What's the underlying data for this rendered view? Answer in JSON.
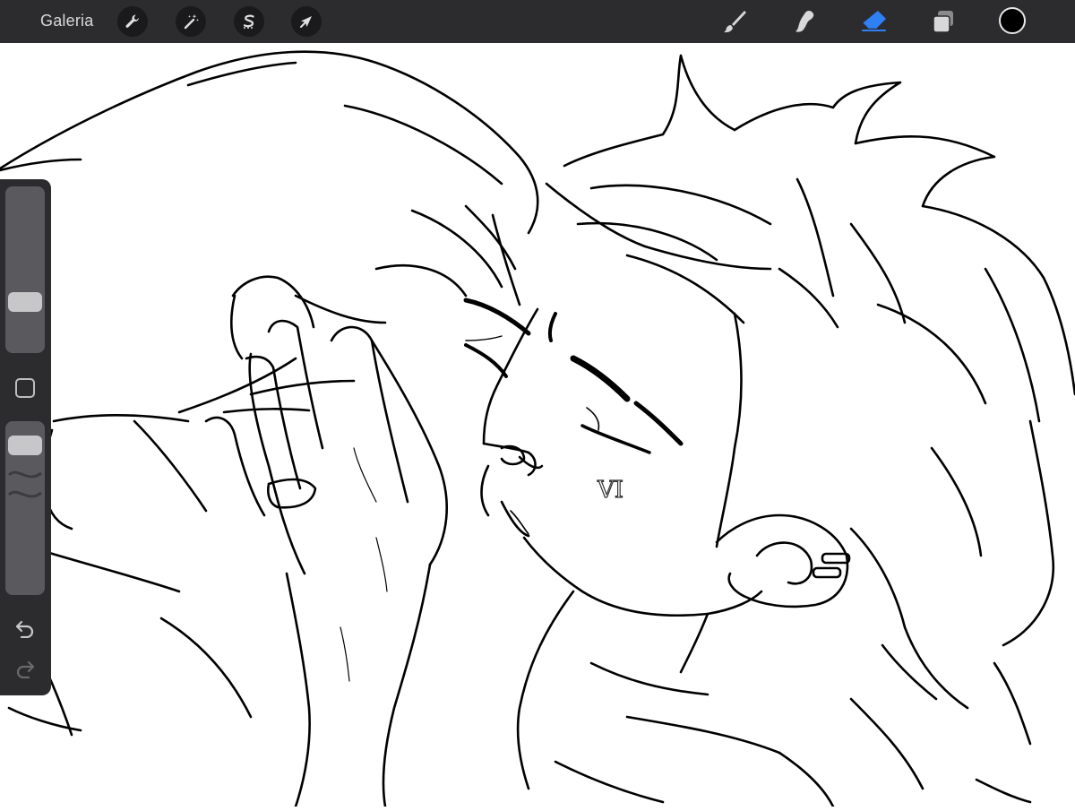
{
  "app": {
    "gallery_label": "Galeria"
  },
  "toolbar": {
    "left_tools": [
      {
        "name": "actions",
        "icon": "wrench-icon"
      },
      {
        "name": "adjustments",
        "icon": "magic-wand-icon"
      },
      {
        "name": "selection",
        "icon": "selection-s-icon"
      },
      {
        "name": "transform",
        "icon": "arrow-cursor-icon"
      }
    ],
    "right_tools": [
      {
        "name": "brush",
        "icon": "brush-icon",
        "active": false
      },
      {
        "name": "smudge",
        "icon": "smudge-icon",
        "active": false
      },
      {
        "name": "eraser",
        "icon": "eraser-icon",
        "active": true
      },
      {
        "name": "layers",
        "icon": "layers-icon",
        "active": false
      }
    ],
    "current_color": "#000000",
    "active_tool_color": "#2f7ff5"
  },
  "sidebar": {
    "brush_size_level": 0.27,
    "opacity_level": 0.08,
    "modify_icon": "square-icon",
    "undo_icon": "undo-arrow-icon",
    "redo_icon": "redo-arrow-icon"
  },
  "canvas": {
    "background": "#ffffff",
    "stroke_color": "#000000"
  }
}
